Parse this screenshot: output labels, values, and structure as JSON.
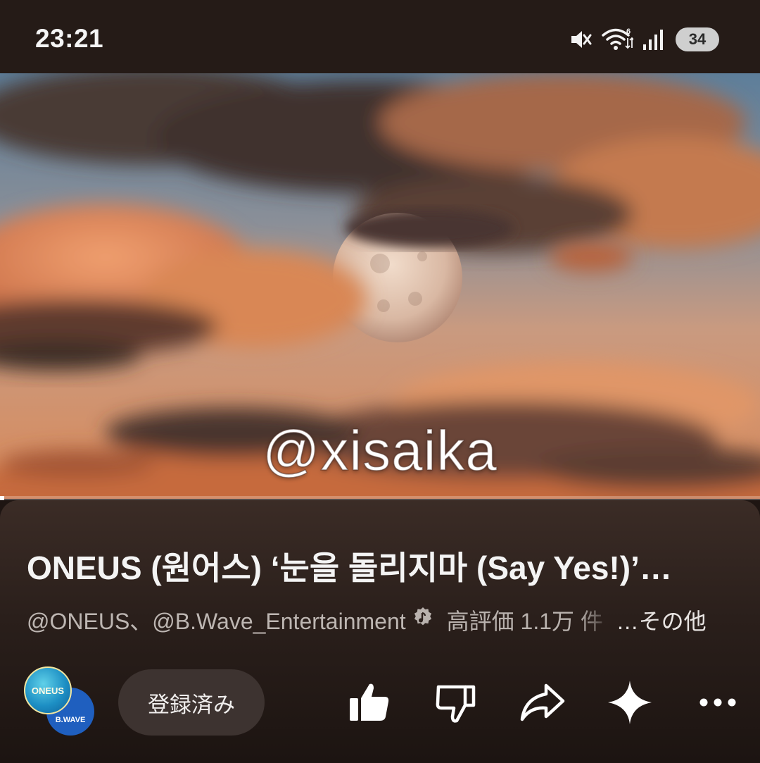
{
  "status_bar": {
    "time": "23:21",
    "battery": "34",
    "icons": [
      "mute-icon",
      "wifi-icon",
      "signal-icon",
      "battery-icon"
    ]
  },
  "video": {
    "watermark": "@xisaika",
    "progress": 0.006
  },
  "info": {
    "title": "ONEUS (원어스) ‘눈을 돌리지마 (Say Yes!)’…",
    "channels": "@ONEUS、@B.Wave_Entertainment",
    "likes": "高評価 1.1万 件",
    "more": "…その他",
    "avatar_oneus": "ONEUS",
    "avatar_bwave": "B.WAVE",
    "subscribe_label": "登録済み"
  },
  "colors": {
    "panel": "#2a1f1b",
    "subscribe_bg": "#3d3330",
    "status_bg": "#251b17"
  }
}
